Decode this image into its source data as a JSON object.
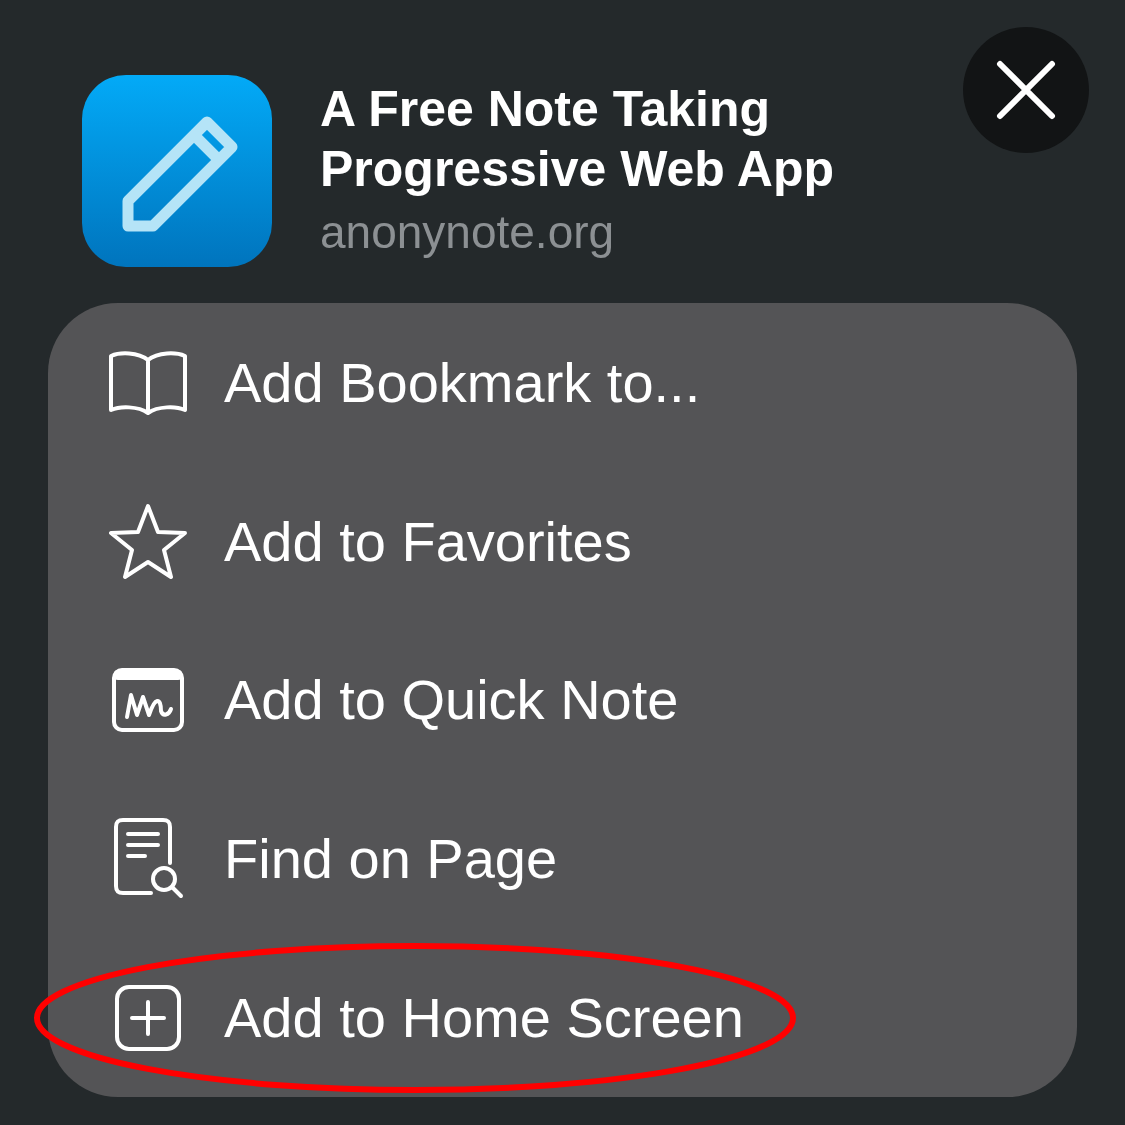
{
  "header": {
    "title_lines": [
      "A Free Note Taking",
      "Progressive Web App"
    ],
    "domain": "anonynote.org"
  },
  "menu": {
    "items": [
      {
        "label": "Add Bookmark to...",
        "kind": "bookmark",
        "circled": false
      },
      {
        "label": "Add to Favorites",
        "kind": "favorite",
        "circled": false
      },
      {
        "label": "Add to Quick Note",
        "kind": "quicknote",
        "circled": false
      },
      {
        "label": "Find on Page",
        "kind": "find",
        "circled": false
      },
      {
        "label": "Add to Home Screen",
        "kind": "homescreen",
        "circled": true
      }
    ]
  }
}
